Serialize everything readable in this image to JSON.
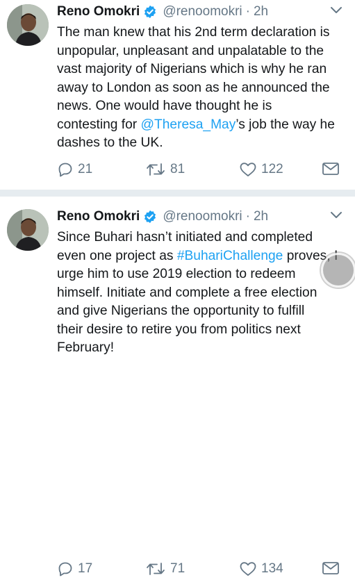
{
  "tweets": [
    {
      "author_name": "Reno Omokri",
      "handle": "@renoomokri",
      "separator": "·",
      "time": "2h",
      "text_before": "The man knew that his 2nd term declaration is\nunpopular, unpleasant and unpalatable to the\nvast majority of Nigerians which is why he ran\naway to London as soon as he announced the\nnews. One would have thought he is\ncontesting for ",
      "link_text": "@Theresa_May",
      "text_after": "’s job the way he\ndashes to the UK.",
      "replies": "21",
      "retweets": "81",
      "likes": "122"
    },
    {
      "author_name": "Reno Omokri",
      "handle": "@renoomokri",
      "separator": "·",
      "time": "2h",
      "text_before": "Since Buhari hasn’t initiated and completed\neven one project as ",
      "link_text": "#BuhariChallenge",
      "text_after": " proves, I\nurge him to use 2019 election to redeem\nhimself. Initiate and complete a free election\nand give Nigerians the opportunity to fulfill\ntheir desire to retire you from politics next\nFebruary!",
      "replies": "17",
      "retweets": "71",
      "likes": "134"
    }
  ],
  "icons": {
    "verified": "verified-badge-icon",
    "caret": "chevron-down-icon",
    "reply": "reply-icon",
    "retweet": "retweet-icon",
    "like": "heart-icon",
    "dm": "envelope-icon"
  },
  "colors": {
    "link": "#1da1f2",
    "muted": "#657786",
    "verified": "#1da1f2",
    "divider": "#e6ecf0"
  }
}
